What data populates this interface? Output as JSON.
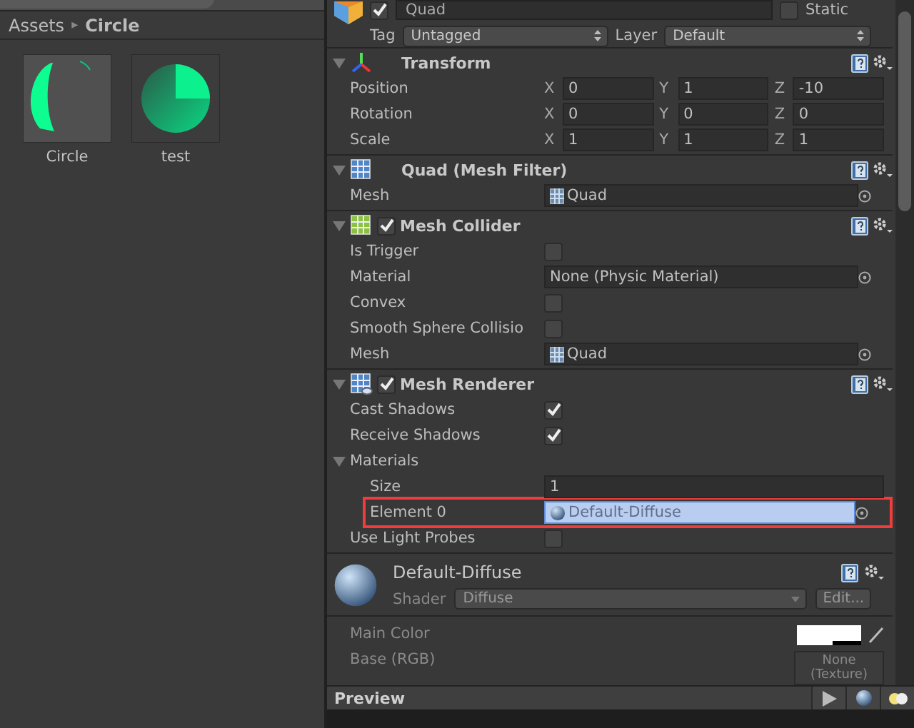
{
  "project": {
    "breadcrumb": [
      {
        "label": "Assets"
      },
      {
        "label": "Circle"
      }
    ],
    "separator": "▸",
    "assets": [
      {
        "name": "Circle",
        "kind": "crescent"
      },
      {
        "name": "test",
        "kind": "radial"
      }
    ]
  },
  "inspector": {
    "object": {
      "active": true,
      "name": "Quad",
      "static_label": "Static",
      "static": false,
      "tag_label": "Tag",
      "tag": "Untagged",
      "layer_label": "Layer",
      "layer": "Default"
    },
    "components": [
      {
        "title": "Transform",
        "kind": "transform",
        "expanded": true,
        "rows": [
          {
            "kind": "vector",
            "label": "Position",
            "values": [
              {
                "axis": "X",
                "value": "0"
              },
              {
                "axis": "Y",
                "value": "1"
              },
              {
                "axis": "Z",
                "value": "-10"
              }
            ]
          },
          {
            "kind": "vector",
            "label": "Rotation",
            "values": [
              {
                "axis": "X",
                "value": "0"
              },
              {
                "axis": "Y",
                "value": "0"
              },
              {
                "axis": "Z",
                "value": "0"
              }
            ]
          },
          {
            "kind": "vector",
            "label": "Scale",
            "values": [
              {
                "axis": "X",
                "value": "1"
              },
              {
                "axis": "Y",
                "value": "1"
              },
              {
                "axis": "Z",
                "value": "1"
              }
            ]
          }
        ]
      },
      {
        "title": "Quad (Mesh Filter)",
        "kind": "filter",
        "expanded": true,
        "rows": [
          {
            "kind": "mesh",
            "label": "Mesh",
            "value": "Quad"
          }
        ]
      },
      {
        "title": "Mesh Collider",
        "kind": "collider",
        "expanded": true,
        "enabled": true,
        "rows": [
          {
            "kind": "check",
            "label": "Is Trigger",
            "checked": false
          },
          {
            "kind": "object",
            "label": "Material",
            "value": "None (Physic Material)"
          },
          {
            "kind": "check",
            "label": "Convex",
            "checked": false
          },
          {
            "kind": "check",
            "label": "Smooth Sphere Collisio",
            "checked": false
          },
          {
            "kind": "mesh",
            "label": "Mesh",
            "value": "Quad"
          }
        ]
      },
      {
        "title": "Mesh Renderer",
        "kind": "renderer",
        "expanded": true,
        "enabled": true,
        "rows": [
          {
            "kind": "check",
            "label": "Cast Shadows",
            "checked": true
          },
          {
            "kind": "check",
            "label": "Receive Shadows",
            "checked": true
          },
          {
            "kind": "group",
            "label": "Materials",
            "expanded": true,
            "children": [
              {
                "kind": "text",
                "label": "Size",
                "value": "1",
                "highlighted": false,
                "selected": false
              },
              {
                "kind": "material",
                "label": "Element 0",
                "value": "Default-Diffuse",
                "highlighted": true,
                "selected": true
              }
            ]
          },
          {
            "kind": "check",
            "label": "Use Light Probes",
            "checked": false
          }
        ]
      }
    ],
    "material": {
      "name": "Default-Diffuse",
      "shader_label": "Shader",
      "shader": "Diffuse",
      "edit_button": "Edit...",
      "properties": [
        {
          "kind": "color",
          "label": "Main Color"
        },
        {
          "kind": "texture",
          "label": "Base (RGB)",
          "value": "None (Texture)"
        }
      ]
    }
  },
  "preview": {
    "title": "Preview"
  }
}
